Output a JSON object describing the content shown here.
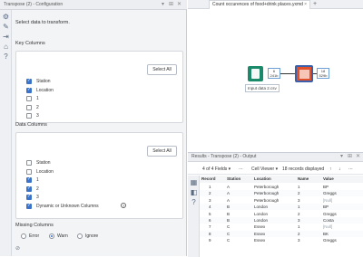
{
  "config": {
    "title": "Transpose (2) - Configuration",
    "intro": "Select data to transform.",
    "select_all": "Select All",
    "key_columns": {
      "heading": "Key Columns",
      "items": [
        {
          "label": "Station",
          "checked": true
        },
        {
          "label": "Location",
          "checked": true
        },
        {
          "label": "1",
          "checked": false
        },
        {
          "label": "2",
          "checked": false
        },
        {
          "label": "3",
          "checked": false
        }
      ]
    },
    "data_columns": {
      "heading": "Data Columns",
      "items": [
        {
          "label": "Station",
          "checked": false
        },
        {
          "label": "Location",
          "checked": false
        },
        {
          "label": "1",
          "checked": true
        },
        {
          "label": "2",
          "checked": true
        },
        {
          "label": "3",
          "checked": true
        },
        {
          "label": "Dynamic or Unknown Columns",
          "checked": true
        }
      ]
    },
    "missing_columns": {
      "heading": "Missing Columns",
      "options": [
        {
          "label": "Error",
          "selected": false
        },
        {
          "label": "Warn",
          "selected": true
        },
        {
          "label": "Ignore",
          "selected": false
        }
      ]
    }
  },
  "workflow": {
    "tab_label": "Count occurences of food+drink places.yxmd",
    "tab_close": "×",
    "tab_add": "+",
    "input_anchor": {
      "line1": "6",
      "line2": "241b"
    },
    "output_anchor": {
      "line1": "18",
      "line2": "529b"
    },
    "input_caption": "Input data 2.csv"
  },
  "results": {
    "title": "Results - Transpose (2) - Output",
    "fields_label": "4 of 4 Fields",
    "viewer_label": "Cell Viewer",
    "records_label": "18 records displayed",
    "columns": [
      "Record",
      "Station",
      "Location",
      "Name",
      "Value"
    ],
    "rows": [
      [
        "1",
        "A",
        "Peterborough",
        "1",
        "BP"
      ],
      [
        "2",
        "A",
        "Peterborough",
        "2",
        "Greggs"
      ],
      [
        "3",
        "A",
        "Peterborough",
        "3",
        "[Null]"
      ],
      [
        "4",
        "B",
        "London",
        "1",
        "BP"
      ],
      [
        "5",
        "B",
        "London",
        "2",
        "Greggs"
      ],
      [
        "6",
        "B",
        "London",
        "3",
        "Costa"
      ],
      [
        "7",
        "C",
        "Essex",
        "1",
        "[Null]"
      ],
      [
        "8",
        "C",
        "Essex",
        "2",
        "BK"
      ],
      [
        "9",
        "C",
        "Essex",
        "3",
        "Greggs"
      ]
    ]
  }
}
